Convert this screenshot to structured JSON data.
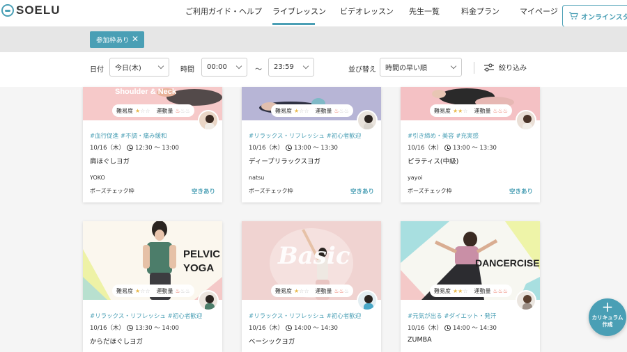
{
  "brand": {
    "name": "SOELU",
    "color": "#4a9fb5"
  },
  "nav": {
    "items": [
      "ご利用ガイド・ヘルプ",
      "ライブレッスン",
      "ビデオレッスン",
      "先生一覧",
      "料金プラン",
      "マイページ"
    ],
    "active": "ライブレッスン",
    "cta_label": "オンラインスタ"
  },
  "filter_chip": {
    "label": "参加枠あり",
    "close": "✕"
  },
  "controls": {
    "date_label": "日付",
    "date_value": "今日(木)",
    "time_label": "時間",
    "time_from": "00:00",
    "time_sep": "〜",
    "time_to": "23:59",
    "sort_label": "並び替え",
    "sort_value": "時間の早い順",
    "filter_label": "絞り込み"
  },
  "labels": {
    "difficulty": "難易度",
    "intensity": "運動量",
    "pose_check": "ポーズチェック枠",
    "available": "空きあり"
  },
  "lessons": [
    {
      "image_text": "Shoulder & Neck",
      "difficulty": 1,
      "intensity": 1,
      "tags": "#血行促進 #不調・痛み緩和",
      "date": "10/16（木）",
      "time": "12:30 ～ 13:00",
      "title": "肩ほぐしヨガ",
      "teacher": "YOKO"
    },
    {
      "image_text": "",
      "difficulty": 1,
      "intensity": 1,
      "tags": "#リラックス・リフレッシュ #初心者歓迎",
      "date": "10/16（木）",
      "time": "13:00 ～ 13:30",
      "title": "ディープリラックスヨガ",
      "teacher": "natsu"
    },
    {
      "image_text": "",
      "difficulty": 2,
      "intensity": 3,
      "tags": "#引き締め・美容 #充実感",
      "date": "10/16（木）",
      "time": "13:00 ～ 13:30",
      "title": "ピラティス(中級)",
      "teacher": "yayoi"
    },
    {
      "image_text": "PELVIC\nYOGA",
      "difficulty": 1,
      "intensity": 1,
      "tags": "#リラックス・リフレッシュ #初心者歓迎",
      "date": "10/16（木）",
      "time": "13:30 ～ 14:00",
      "title": "からだほぐしヨガ",
      "teacher": ""
    },
    {
      "image_text": "Basic",
      "difficulty": 1,
      "intensity": 2,
      "tags": "#リラックス・リフレッシュ #初心者歓迎",
      "date": "10/16（木）",
      "time": "14:00 ～ 14:30",
      "title": "ベーシックヨガ",
      "teacher": ""
    },
    {
      "image_text": "DANCERCISE",
      "difficulty": 2,
      "intensity": 3,
      "tags": "#元気が出る #ダイエット・発汗",
      "date": "10/16（木）",
      "time": "14:00 ～ 14:30",
      "title": "ZUMBA",
      "teacher": ""
    }
  ],
  "fab": {
    "plus": "+",
    "label": "カリキュラム\n作成"
  }
}
